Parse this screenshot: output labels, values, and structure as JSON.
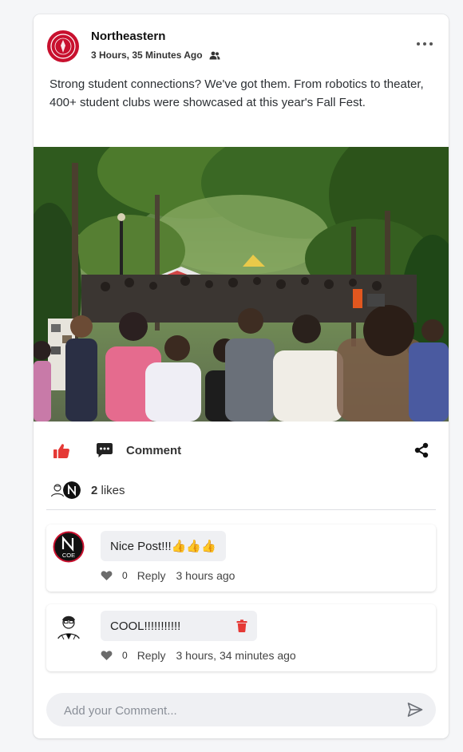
{
  "post": {
    "author": "Northeastern",
    "time": "3 Hours, 35 Minutes Ago",
    "visibility_icon": "people-icon",
    "text": "Strong student connections? We've got them. From robotics to theater, 400+ student clubs were showcased at this year's Fall Fest."
  },
  "actions": {
    "comment_label": "Comment"
  },
  "likes": {
    "count": "2",
    "label": "likes"
  },
  "comments": [
    {
      "text": "Nice Post!!!👍👍👍",
      "like_count": "0",
      "reply_label": "Reply",
      "time": "3 hours ago",
      "avatar_text": "COE"
    },
    {
      "text": "COOL!!!!!!!!!!!",
      "like_count": "0",
      "reply_label": "Reply",
      "time": "3 hours, 34 minutes ago"
    }
  ],
  "input": {
    "placeholder": "Add your Comment..."
  },
  "colors": {
    "brand_red": "#c8102e",
    "like_active": "#e53935",
    "delete_red": "#e53935",
    "bubble_bg": "#eff0f3"
  }
}
